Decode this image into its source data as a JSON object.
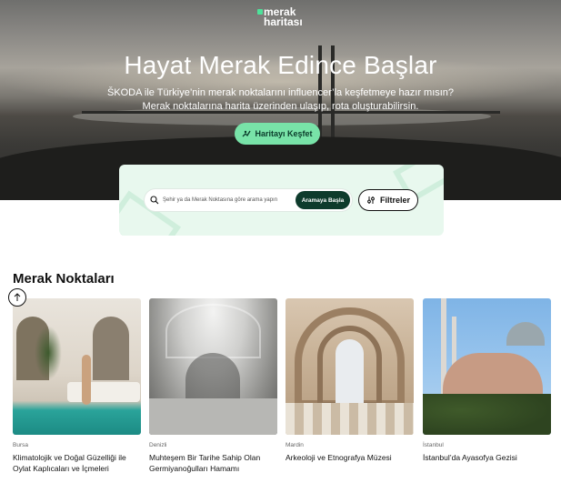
{
  "logo": {
    "line1": "merak",
    "line2": "haritası"
  },
  "hero": {
    "title": "Hayat Merak Edince Başlar",
    "subtitle_line1": "ŠKODA ile Türkiye’nin merak noktalarını influencer’la keşfetmeye hazır mısın?",
    "subtitle_line2": "Merak noktalarına harita üzerinden ulaşıp, rota oluşturabilirsin.",
    "cta_label": "Haritayı Keşfet"
  },
  "search": {
    "placeholder": "Şehir ya da Merak Noktasına göre arama yapın",
    "button_label": "Aramaya Başla",
    "filter_label": "Filtreler"
  },
  "section": {
    "title": "Merak Noktaları"
  },
  "cards": [
    {
      "city": "Bursa",
      "name_line1": "Klimatolojik ve Doğal Güzelliği ile",
      "name_line2": "Oylat Kaplıcaları ve İçmeleri"
    },
    {
      "city": "Denizli",
      "name_line1": "Muhteşem Bir Tarihe Sahip Olan",
      "name_line2": "Germiyanoğulları Hamamı"
    },
    {
      "city": "Mardin",
      "name_line1": "Arkeoloji ve Etnografya Müzesi",
      "name_line2": ""
    },
    {
      "city": "İstanbul",
      "name_line1": "İstanbul’da Ayasofya Gezisi",
      "name_line2": ""
    }
  ],
  "colors": {
    "accent": "#78e3a8",
    "dark_green": "#0e3b2c",
    "panel_bg": "#e8f8ee"
  }
}
